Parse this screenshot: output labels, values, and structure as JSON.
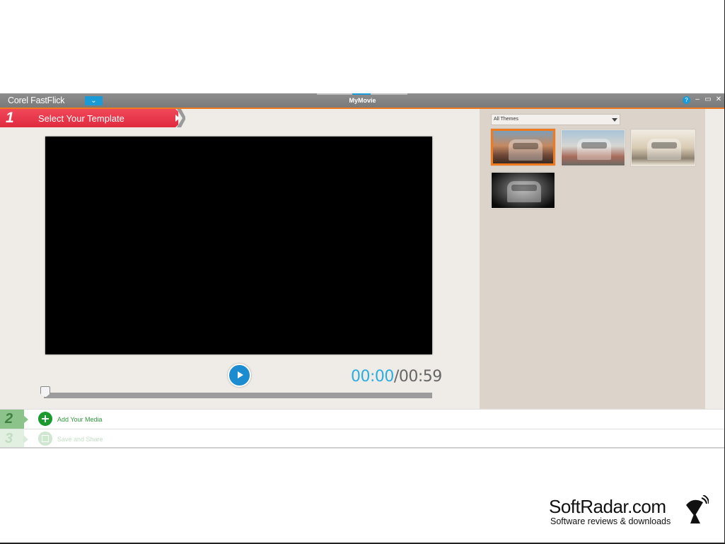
{
  "window": {
    "app_name": "Corel FastFlick",
    "document_title": "MyMovie",
    "controls": {
      "help": "?",
      "minimize": "–",
      "restore": "▭",
      "close": "✕"
    }
  },
  "step1": {
    "number": "1",
    "label": "Select Your Template"
  },
  "player": {
    "current_time": "00:00",
    "separator": "/",
    "total_time": "00:59",
    "progress": 0
  },
  "themes": {
    "filter_value": "All Themes",
    "selected_index": 0,
    "thumbnails": [
      "theme-1",
      "theme-2",
      "theme-3",
      "theme-4"
    ]
  },
  "step2": {
    "number": "2",
    "label": "Add Your Media"
  },
  "step3": {
    "number": "3",
    "label": "Save and Share"
  },
  "watermark": {
    "title": "SoftRadar.com",
    "subtitle": "Software reviews & downloads"
  },
  "colors": {
    "accent": "#f07a1f",
    "step1": "#e83447",
    "blue": "#1a9ad6",
    "green": "#1b9a2e"
  }
}
